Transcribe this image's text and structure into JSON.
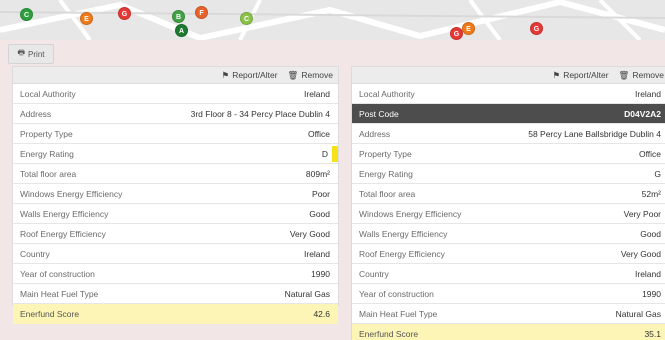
{
  "toolbar": {
    "print_label": "Print",
    "print_icon": "print-icon"
  },
  "map": {
    "markers": [
      {
        "letter": "C",
        "color": "#2e9e3e"
      },
      {
        "letter": "E",
        "color": "#f07a1a"
      },
      {
        "letter": "G",
        "color": "#e53935"
      },
      {
        "letter": "B",
        "color": "#43a047"
      },
      {
        "letter": "A",
        "color": "#1b7a2f"
      },
      {
        "letter": "F",
        "color": "#e8622c"
      },
      {
        "letter": "C",
        "color": "#8bc34a"
      },
      {
        "letter": "G",
        "color": "#e53935"
      },
      {
        "letter": "E",
        "color": "#f07a1a"
      },
      {
        "letter": "G",
        "color": "#e53935"
      }
    ]
  },
  "left_panel": {
    "report_label": "Report/Alter",
    "remove_label": "Remove",
    "rows": [
      {
        "label": "Local Authority",
        "value": "Ireland"
      },
      {
        "label": "Address",
        "value": "3rd Floor 8 - 34 Percy Place Dublin 4"
      },
      {
        "label": "Property Type",
        "value": "Office"
      },
      {
        "label": "Energy Rating",
        "value": "D"
      },
      {
        "label": "Total floor area",
        "value": "809m²"
      },
      {
        "label": "Windows Energy Efficiency",
        "value": "Poor"
      },
      {
        "label": "Walls Energy Efficiency",
        "value": "Good"
      },
      {
        "label": "Roof Energy Efficiency",
        "value": "Very Good"
      },
      {
        "label": "Country",
        "value": "Ireland"
      },
      {
        "label": "Year of construction",
        "value": "1990"
      },
      {
        "label": "Main Heat Fuel Type",
        "value": "Natural Gas"
      },
      {
        "label": "Enerfund Score",
        "value": "42.6"
      }
    ],
    "rating_color": "#f7e11b"
  },
  "right_panel": {
    "report_label": "Report/Alter",
    "remove_label": "Remove",
    "rows": [
      {
        "label": "Local Authority",
        "value": "Ireland"
      },
      {
        "label": "Post Code",
        "value": "D04V2A2"
      },
      {
        "label": "Address",
        "value": "58 Percy Lane Ballsbridge Dublin 4"
      },
      {
        "label": "Property Type",
        "value": "Office"
      },
      {
        "label": "Energy Rating",
        "value": "G"
      },
      {
        "label": "Total floor area",
        "value": "52m²"
      },
      {
        "label": "Windows Energy Efficiency",
        "value": "Very Poor"
      },
      {
        "label": "Walls Energy Efficiency",
        "value": "Good"
      },
      {
        "label": "Roof Energy Efficiency",
        "value": "Very Good"
      },
      {
        "label": "Country",
        "value": "Ireland"
      },
      {
        "label": "Year of construction",
        "value": "1990"
      },
      {
        "label": "Main Heat Fuel Type",
        "value": "Natural Gas"
      },
      {
        "label": "Enerfund Score",
        "value": "35.1"
      }
    ]
  },
  "colors": {
    "highlight_row": "#fdf5b6",
    "dark_row": "#4d4d4d",
    "background": "#f3e6e6"
  }
}
